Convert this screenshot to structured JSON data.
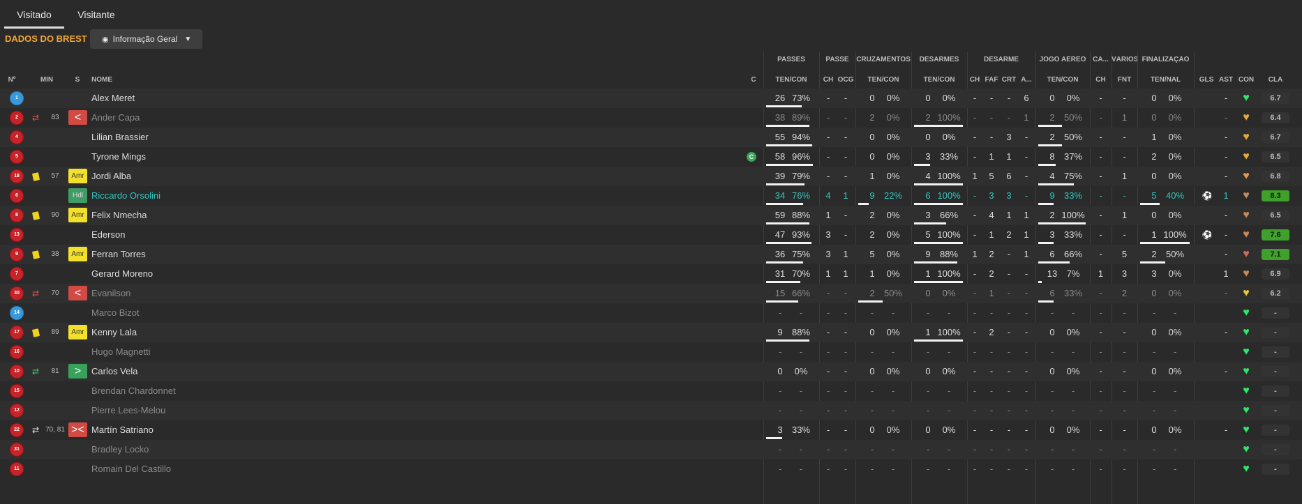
{
  "tabs": [
    {
      "label": "Visitado"
    },
    {
      "label": "Visitante"
    }
  ],
  "title": "DADOS DO BREST",
  "view_dropdown": {
    "label": "Informação Geral"
  },
  "groups": [
    "PASSES",
    "PASSE",
    "CRUZAMENTOS",
    "DESARMES",
    "DESARME",
    "JOGO AÉREO",
    "CA...",
    "VÁRIOS",
    "FINALIZAÇÃO"
  ],
  "columns": {
    "num": "Nº",
    "min": "MIN",
    "s": "S",
    "name": "NOME",
    "c": "C",
    "passes": "TEN/CON",
    "ch": "CH",
    "ocg": "OCG",
    "cruz": "TEN/CON",
    "des": "TEN/CON",
    "dch": "CH",
    "faf": "FAF",
    "crt": "CRT",
    "a": "A...",
    "aereo": "TEN/CON",
    "cach": "CH",
    "fnt": "FNT",
    "fin": "TEN/NAL",
    "gls": "GLS",
    "ast": "AST",
    "con": "CON",
    "cla": "CLA"
  },
  "players": [
    {
      "num": "1",
      "gk": true,
      "min": "",
      "card": false,
      "sub": "",
      "s": "",
      "name": "Alex Meret",
      "style": "",
      "captain": false,
      "pass_t": "26",
      "pass_p": "73%",
      "pass_v": 73,
      "ch": "-",
      "ocg": "-",
      "cz_t": "0",
      "cz_p": "0%",
      "cz_v": 0,
      "ds_t": "0",
      "ds_p": "0%",
      "ds_v": 0,
      "d_ch": "-",
      "faf": "-",
      "crt": "-",
      "a": "6",
      "ae_t": "0",
      "ae_p": "0%",
      "ae_v": 0,
      "ca": "-",
      "fnt": "-",
      "fi_t": "0",
      "fi_p": "0%",
      "fi_v": 0,
      "gls": "",
      "ast": "-",
      "con": "#2ee86a",
      "cla": "6.7",
      "cla_green": false
    },
    {
      "num": "2",
      "gk": false,
      "min": "83",
      "card": false,
      "sub": "out",
      "s": "<",
      "name": "Ander Capa",
      "style": "muted",
      "captain": false,
      "pass_t": "38",
      "pass_p": "89%",
      "pass_v": 89,
      "ch": "-",
      "ocg": "-",
      "cz_t": "2",
      "cz_p": "0%",
      "cz_v": 0,
      "ds_t": "2",
      "ds_p": "100%",
      "ds_v": 100,
      "d_ch": "-",
      "faf": "-",
      "crt": "-",
      "a": "1",
      "ae_t": "2",
      "ae_p": "50%",
      "ae_v": 50,
      "ca": "-",
      "fnt": "1",
      "fi_t": "0",
      "fi_p": "0%",
      "fi_v": 0,
      "gls": "",
      "ast": "-",
      "con": "#e8a93a",
      "cla": "6.4",
      "cla_green": false
    },
    {
      "num": "4",
      "gk": false,
      "min": "",
      "card": false,
      "sub": "",
      "s": "",
      "name": "Lilian Brassier",
      "style": "",
      "captain": false,
      "pass_t": "55",
      "pass_p": "94%",
      "pass_v": 94,
      "ch": "-",
      "ocg": "-",
      "cz_t": "0",
      "cz_p": "0%",
      "cz_v": 0,
      "ds_t": "0",
      "ds_p": "0%",
      "ds_v": 0,
      "d_ch": "-",
      "faf": "-",
      "crt": "3",
      "a": "-",
      "ae_t": "2",
      "ae_p": "50%",
      "ae_v": 50,
      "ca": "-",
      "fnt": "-",
      "fi_t": "1",
      "fi_p": "0%",
      "fi_v": 0,
      "gls": "",
      "ast": "-",
      "con": "#e8a93a",
      "cla": "6.7",
      "cla_green": false
    },
    {
      "num": "5",
      "gk": false,
      "min": "",
      "card": false,
      "sub": "",
      "s": "",
      "name": "Tyrone Mings",
      "style": "",
      "captain": true,
      "captain_label": "C",
      "pass_t": "58",
      "pass_p": "96%",
      "pass_v": 96,
      "ch": "-",
      "ocg": "-",
      "cz_t": "0",
      "cz_p": "0%",
      "cz_v": 0,
      "ds_t": "3",
      "ds_p": "33%",
      "ds_v": 33,
      "d_ch": "-",
      "faf": "1",
      "crt": "1",
      "a": "-",
      "ae_t": "8",
      "ae_p": "37%",
      "ae_v": 37,
      "ca": "-",
      "fnt": "-",
      "fi_t": "2",
      "fi_p": "0%",
      "fi_v": 0,
      "gls": "",
      "ast": "-",
      "con": "#e8a93a",
      "cla": "6.5",
      "cla_green": false
    },
    {
      "num": "18",
      "gk": false,
      "min": "57",
      "card": true,
      "sub": "",
      "s": "Amr",
      "name": "Jordi Alba",
      "style": "",
      "captain": false,
      "pass_t": "39",
      "pass_p": "79%",
      "pass_v": 79,
      "ch": "-",
      "ocg": "-",
      "cz_t": "1",
      "cz_p": "0%",
      "cz_v": 0,
      "ds_t": "4",
      "ds_p": "100%",
      "ds_v": 100,
      "d_ch": "1",
      "faf": "5",
      "crt": "6",
      "a": "-",
      "ae_t": "4",
      "ae_p": "75%",
      "ae_v": 75,
      "ca": "-",
      "fnt": "1",
      "fi_t": "0",
      "fi_p": "0%",
      "fi_v": 0,
      "gls": "",
      "ast": "-",
      "con": "#e89a4a",
      "cla": "6.8",
      "cla_green": false
    },
    {
      "num": "6",
      "gk": false,
      "min": "",
      "card": false,
      "sub": "",
      "s": "Hdl",
      "name": "Riccardo Orsolini",
      "style": "cyan",
      "captain": false,
      "pass_t": "34",
      "pass_p": "76%",
      "pass_v": 76,
      "ch": "4",
      "ocg": "1",
      "cz_t": "9",
      "cz_p": "22%",
      "cz_v": 22,
      "ds_t": "6",
      "ds_p": "100%",
      "ds_v": 100,
      "d_ch": "-",
      "faf": "3",
      "crt": "3",
      "a": "-",
      "ae_t": "9",
      "ae_p": "33%",
      "ae_v": 33,
      "ca": "-",
      "fnt": "-",
      "fi_t": "5",
      "fi_p": "40%",
      "fi_v": 40,
      "gls": "ball",
      "ast": "1",
      "con": "#c98a5a",
      "cla": "8.3",
      "cla_green": true
    },
    {
      "num": "8",
      "gk": false,
      "min": "90",
      "card": true,
      "sub": "",
      "s": "Amr",
      "name": "Felix Nmecha",
      "style": "",
      "captain": false,
      "pass_t": "59",
      "pass_p": "88%",
      "pass_v": 88,
      "ch": "1",
      "ocg": "-",
      "cz_t": "2",
      "cz_p": "0%",
      "cz_v": 0,
      "ds_t": "3",
      "ds_p": "66%",
      "ds_v": 66,
      "d_ch": "-",
      "faf": "4",
      "crt": "1",
      "a": "1",
      "ae_t": "2",
      "ae_p": "100%",
      "ae_v": 100,
      "ca": "-",
      "fnt": "1",
      "fi_t": "0",
      "fi_p": "0%",
      "fi_v": 0,
      "gls": "",
      "ast": "-",
      "con": "#c98a5a",
      "cla": "6.5",
      "cla_green": false
    },
    {
      "num": "13",
      "gk": false,
      "min": "",
      "card": false,
      "sub": "",
      "s": "",
      "name": "Ederson",
      "style": "",
      "captain": false,
      "pass_t": "47",
      "pass_p": "93%",
      "pass_v": 93,
      "ch": "3",
      "ocg": "-",
      "cz_t": "2",
      "cz_p": "0%",
      "cz_v": 0,
      "ds_t": "5",
      "ds_p": "100%",
      "ds_v": 100,
      "d_ch": "-",
      "faf": "1",
      "crt": "2",
      "a": "1",
      "ae_t": "3",
      "ae_p": "33%",
      "ae_v": 33,
      "ca": "-",
      "fnt": "-",
      "fi_t": "1",
      "fi_p": "100%",
      "fi_v": 100,
      "gls": "ball",
      "ast": "-",
      "con": "#c98a5a",
      "cla": "7.6",
      "cla_green": true
    },
    {
      "num": "9",
      "gk": false,
      "min": "38",
      "card": true,
      "sub": "",
      "s": "Amr",
      "name": "Ferran Torres",
      "style": "",
      "captain": false,
      "pass_t": "36",
      "pass_p": "75%",
      "pass_v": 75,
      "ch": "3",
      "ocg": "1",
      "cz_t": "5",
      "cz_p": "0%",
      "cz_v": 0,
      "ds_t": "9",
      "ds_p": "88%",
      "ds_v": 88,
      "d_ch": "1",
      "faf": "2",
      "crt": "-",
      "a": "1",
      "ae_t": "6",
      "ae_p": "66%",
      "ae_v": 66,
      "ca": "-",
      "fnt": "5",
      "fi_t": "2",
      "fi_p": "50%",
      "fi_v": 50,
      "gls": "",
      "ast": "-",
      "con": "#d06a5a",
      "cla": "7.1",
      "cla_green": true
    },
    {
      "num": "7",
      "gk": false,
      "min": "",
      "card": false,
      "sub": "",
      "s": "",
      "name": "Gerard Moreno",
      "style": "",
      "captain": false,
      "pass_t": "31",
      "pass_p": "70%",
      "pass_v": 70,
      "ch": "1",
      "ocg": "1",
      "cz_t": "1",
      "cz_p": "0%",
      "cz_v": 0,
      "ds_t": "1",
      "ds_p": "100%",
      "ds_v": 100,
      "d_ch": "-",
      "faf": "2",
      "crt": "-",
      "a": "-",
      "ae_t": "13",
      "ae_p": "7%",
      "ae_v": 7,
      "ca": "1",
      "fnt": "3",
      "fi_t": "3",
      "fi_p": "0%",
      "fi_v": 0,
      "gls": "",
      "ast": "1",
      "con": "#c98a5a",
      "cla": "6.9",
      "cla_green": false
    },
    {
      "num": "30",
      "gk": false,
      "min": "70",
      "card": false,
      "sub": "out",
      "s": "<",
      "name": "Evanilson",
      "style": "muted",
      "captain": false,
      "pass_t": "15",
      "pass_p": "66%",
      "pass_v": 66,
      "ch": "-",
      "ocg": "-",
      "cz_t": "2",
      "cz_p": "50%",
      "cz_v": 50,
      "ds_t": "0",
      "ds_p": "0%",
      "ds_v": 0,
      "d_ch": "-",
      "faf": "1",
      "crt": "-",
      "a": "-",
      "ae_t": "6",
      "ae_p": "33%",
      "ae_v": 33,
      "ca": "-",
      "fnt": "2",
      "fi_t": "0",
      "fi_p": "0%",
      "fi_v": 0,
      "gls": "",
      "ast": "-",
      "con": "#e8c83a",
      "cla": "6.2",
      "cla_green": false
    },
    {
      "num": "14",
      "gk": true,
      "min": "",
      "card": false,
      "sub": "",
      "s": "",
      "name": "Marco Bizot",
      "style": "muted",
      "captain": false,
      "pass_t": "-",
      "pass_p": "-",
      "pass_v": 0,
      "ch": "-",
      "ocg": "-",
      "cz_t": "-",
      "cz_p": "-",
      "cz_v": 0,
      "ds_t": "-",
      "ds_p": "-",
      "ds_v": 0,
      "d_ch": "-",
      "faf": "-",
      "crt": "-",
      "a": "-",
      "ae_t": "-",
      "ae_p": "-",
      "ae_v": 0,
      "ca": "-",
      "fnt": "-",
      "fi_t": "-",
      "fi_p": "-",
      "fi_v": 0,
      "gls": "",
      "ast": "",
      "con": "#2ee86a",
      "cla": "-",
      "cla_green": false
    },
    {
      "num": "17",
      "gk": false,
      "min": "89",
      "card": true,
      "sub": "",
      "s": "Amr",
      "name": "Kenny Lala",
      "style": "",
      "captain": false,
      "pass_t": "9",
      "pass_p": "88%",
      "pass_v": 88,
      "ch": "-",
      "ocg": "-",
      "cz_t": "0",
      "cz_p": "0%",
      "cz_v": 0,
      "ds_t": "1",
      "ds_p": "100%",
      "ds_v": 100,
      "d_ch": "-",
      "faf": "2",
      "crt": "-",
      "a": "-",
      "ae_t": "0",
      "ae_p": "0%",
      "ae_v": 0,
      "ca": "-",
      "fnt": "-",
      "fi_t": "0",
      "fi_p": "0%",
      "fi_v": 0,
      "gls": "",
      "ast": "-",
      "con": "#2ee86a",
      "cla": "-",
      "cla_green": false
    },
    {
      "num": "16",
      "gk": false,
      "min": "",
      "card": false,
      "sub": "",
      "s": "",
      "name": "Hugo Magnetti",
      "style": "muted",
      "captain": false,
      "pass_t": "-",
      "pass_p": "-",
      "pass_v": 0,
      "ch": "-",
      "ocg": "-",
      "cz_t": "-",
      "cz_p": "-",
      "cz_v": 0,
      "ds_t": "-",
      "ds_p": "-",
      "ds_v": 0,
      "d_ch": "-",
      "faf": "-",
      "crt": "-",
      "a": "-",
      "ae_t": "-",
      "ae_p": "-",
      "ae_v": 0,
      "ca": "-",
      "fnt": "-",
      "fi_t": "-",
      "fi_p": "-",
      "fi_v": 0,
      "gls": "",
      "ast": "",
      "con": "#2ee86a",
      "cla": "-",
      "cla_green": false
    },
    {
      "num": "10",
      "gk": false,
      "min": "81",
      "card": false,
      "sub": "in",
      "s": ">",
      "name": "Carlos Vela",
      "style": "",
      "captain": false,
      "pass_t": "0",
      "pass_p": "0%",
      "pass_v": 0,
      "ch": "-",
      "ocg": "-",
      "cz_t": "0",
      "cz_p": "0%",
      "cz_v": 0,
      "ds_t": "0",
      "ds_p": "0%",
      "ds_v": 0,
      "d_ch": "-",
      "faf": "-",
      "crt": "-",
      "a": "-",
      "ae_t": "0",
      "ae_p": "0%",
      "ae_v": 0,
      "ca": "-",
      "fnt": "-",
      "fi_t": "0",
      "fi_p": "0%",
      "fi_v": 0,
      "gls": "",
      "ast": "-",
      "con": "#2ee86a",
      "cla": "-",
      "cla_green": false
    },
    {
      "num": "15",
      "gk": false,
      "min": "",
      "card": false,
      "sub": "",
      "s": "",
      "name": "Brendan Chardonnet",
      "style": "muted",
      "captain": false,
      "pass_t": "-",
      "pass_p": "-",
      "pass_v": 0,
      "ch": "-",
      "ocg": "-",
      "cz_t": "-",
      "cz_p": "-",
      "cz_v": 0,
      "ds_t": "-",
      "ds_p": "-",
      "ds_v": 0,
      "d_ch": "-",
      "faf": "-",
      "crt": "-",
      "a": "-",
      "ae_t": "-",
      "ae_p": "-",
      "ae_v": 0,
      "ca": "-",
      "fnt": "-",
      "fi_t": "-",
      "fi_p": "-",
      "fi_v": 0,
      "gls": "",
      "ast": "",
      "con": "#2ee86a",
      "cla": "-",
      "cla_green": false
    },
    {
      "num": "12",
      "gk": false,
      "min": "",
      "card": false,
      "sub": "",
      "s": "",
      "name": "Pierre Lees-Melou",
      "style": "muted",
      "captain": false,
      "pass_t": "-",
      "pass_p": "-",
      "pass_v": 0,
      "ch": "-",
      "ocg": "-",
      "cz_t": "-",
      "cz_p": "-",
      "cz_v": 0,
      "ds_t": "-",
      "ds_p": "-",
      "ds_v": 0,
      "d_ch": "-",
      "faf": "-",
      "crt": "-",
      "a": "-",
      "ae_t": "-",
      "ae_p": "-",
      "ae_v": 0,
      "ca": "-",
      "fnt": "-",
      "fi_t": "-",
      "fi_p": "-",
      "fi_v": 0,
      "gls": "",
      "ast": "",
      "con": "#2ee86a",
      "cla": "-",
      "cla_green": false
    },
    {
      "num": "22",
      "gk": false,
      "min": "70, 81",
      "card": false,
      "sub": "inout",
      "s": "><",
      "name": "Martín Satriano",
      "style": "",
      "captain": false,
      "pass_t": "3",
      "pass_p": "33%",
      "pass_v": 33,
      "ch": "-",
      "ocg": "-",
      "cz_t": "0",
      "cz_p": "0%",
      "cz_v": 0,
      "ds_t": "0",
      "ds_p": "0%",
      "ds_v": 0,
      "d_ch": "-",
      "faf": "-",
      "crt": "-",
      "a": "-",
      "ae_t": "0",
      "ae_p": "0%",
      "ae_v": 0,
      "ca": "-",
      "fnt": "-",
      "fi_t": "0",
      "fi_p": "0%",
      "fi_v": 0,
      "gls": "",
      "ast": "-",
      "con": "#2ee86a",
      "cla": "-",
      "cla_green": false
    },
    {
      "num": "31",
      "gk": false,
      "min": "",
      "card": false,
      "sub": "",
      "s": "",
      "name": "Bradley Locko",
      "style": "muted",
      "captain": false,
      "pass_t": "-",
      "pass_p": "-",
      "pass_v": 0,
      "ch": "-",
      "ocg": "-",
      "cz_t": "-",
      "cz_p": "-",
      "cz_v": 0,
      "ds_t": "-",
      "ds_p": "-",
      "ds_v": 0,
      "d_ch": "-",
      "faf": "-",
      "crt": "-",
      "a": "-",
      "ae_t": "-",
      "ae_p": "-",
      "ae_v": 0,
      "ca": "-",
      "fnt": "-",
      "fi_t": "-",
      "fi_p": "-",
      "fi_v": 0,
      "gls": "",
      "ast": "",
      "con": "#2ee86a",
      "cla": "-",
      "cla_green": false
    },
    {
      "num": "11",
      "gk": false,
      "min": "",
      "card": false,
      "sub": "",
      "s": "",
      "name": "Romain Del Castillo",
      "style": "muted",
      "captain": false,
      "pass_t": "-",
      "pass_p": "-",
      "pass_v": 0,
      "ch": "-",
      "ocg": "-",
      "cz_t": "-",
      "cz_p": "-",
      "cz_v": 0,
      "ds_t": "-",
      "ds_p": "-",
      "ds_v": 0,
      "d_ch": "-",
      "faf": "-",
      "crt": "-",
      "a": "-",
      "ae_t": "-",
      "ae_p": "-",
      "ae_v": 0,
      "ca": "-",
      "fnt": "-",
      "fi_t": "-",
      "fi_p": "-",
      "fi_v": 0,
      "gls": "",
      "ast": "",
      "con": "#2ee86a",
      "cla": "-",
      "cla_green": false
    }
  ]
}
